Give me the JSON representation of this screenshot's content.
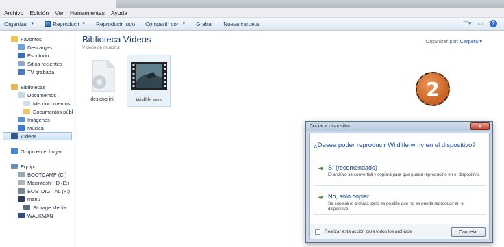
{
  "menubar": [
    "Archivo",
    "Edición",
    "Ver",
    "Herramientas",
    "Ayuda"
  ],
  "toolbar": {
    "organize": "Organizar",
    "play": "Reproducir",
    "play_all": "Reproducir todo",
    "share": "Compartir con",
    "burn": "Grabar",
    "new_folder": "Nueva carpeta"
  },
  "nav": {
    "favorites": "Favoritos",
    "downloads": "Descargas",
    "desktop": "Escritorio",
    "recent": "Sitios recientes",
    "tv": "TV grabada",
    "libraries": "Bibliotecas",
    "documents": "Documentos",
    "my_documents": "Mis documentos",
    "public_documents": "Documentos públ",
    "images": "Imágenes",
    "music": "Música",
    "videos": "Vídeos",
    "homegroup": "Grupo en el hogar",
    "computer": "Equipo",
    "drive_c": "BOOTCAMP (C:)",
    "drive_e": "Macintosh HD (E:)",
    "drive_f": "EOS_DIGITAL (F:)",
    "manu": "manu",
    "storage": "Storage Media",
    "walkman": "WALKMAN"
  },
  "content": {
    "title": "Biblioteca Vídeos",
    "subtitle": "Vídeos de muestra",
    "arrange_label": "Organizar por:",
    "arrange_value": "Carpeta",
    "files": [
      "desktop.ini",
      "Wildlife.wmv"
    ]
  },
  "badge": "2",
  "dialog": {
    "title": "Copiar a dispositivo",
    "close": "x",
    "question": "¿Desea poder reproducir Wildlife.wmv en el dispositivo?",
    "opt1_title": "Sí (recomendado)",
    "opt1_desc": "El archivo se convertirá y copiará para que pueda reproducirlo en el dispositivo.",
    "opt2_title": "No, sólo copiar",
    "opt2_desc": "Se copiará el archivo, pero es posible que no se pueda reproducir en el dispositivo.",
    "checkbox": "Realizar esta acción para todos los archivos",
    "cancel": "Cancelar"
  }
}
